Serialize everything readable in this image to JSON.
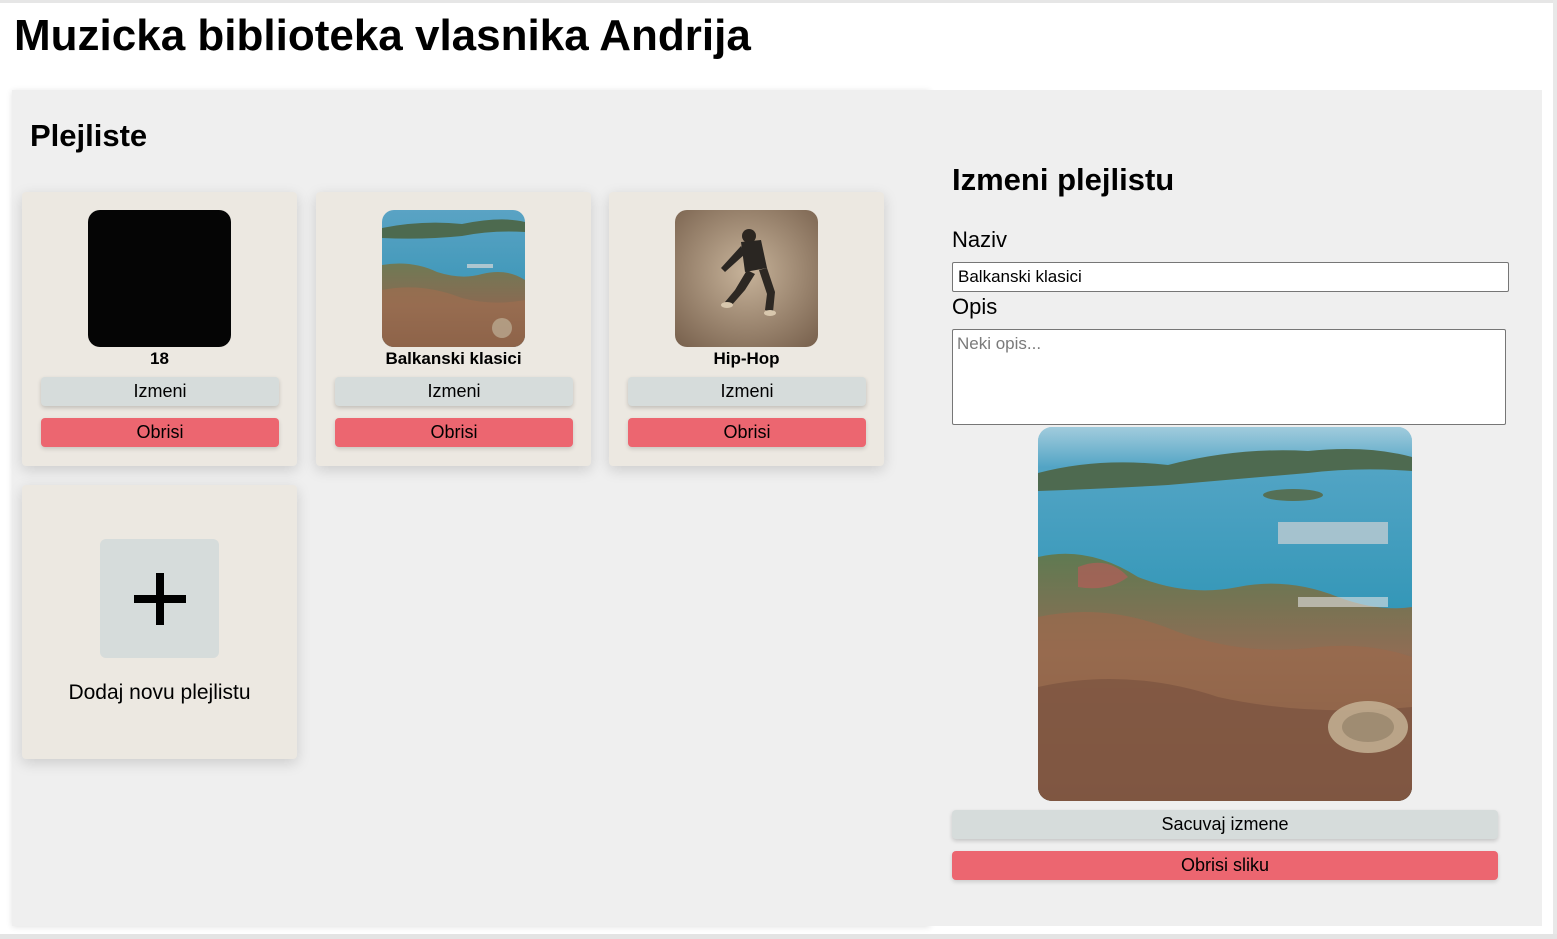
{
  "page": {
    "title": "Muzicka biblioteka vlasnika Andrija"
  },
  "playlists_section": {
    "title": "Plejliste",
    "items": [
      {
        "name": "18",
        "cover": "black-square-cover",
        "edit_label": "Izmeni",
        "delete_label": "Obrisi"
      },
      {
        "name": "Balkanski klasici",
        "cover": "aerial-coastal-city-photo",
        "edit_label": "Izmeni",
        "delete_label": "Obrisi"
      },
      {
        "name": "Hip-Hop",
        "cover": "jumping-person-photo",
        "edit_label": "Izmeni",
        "delete_label": "Obrisi"
      }
    ],
    "add_card": {
      "icon": "plus-icon",
      "label": "Dodaj novu plejlistu"
    }
  },
  "edit_panel": {
    "title": "Izmeni plejlistu",
    "name_label": "Naziv",
    "name_value": "Balkanski klasici",
    "description_label": "Opis",
    "description_value": "",
    "description_placeholder": "Neki opis...",
    "cover": "aerial-coastal-city-photo",
    "save_label": "Sacuvaj izmene",
    "delete_image_label": "Obrisi sliku"
  },
  "colors": {
    "panel_bg": "#efefef",
    "card_bg": "#ece8e1",
    "edit_button": "#d6dcdb",
    "delete_button": "#ec6670"
  }
}
